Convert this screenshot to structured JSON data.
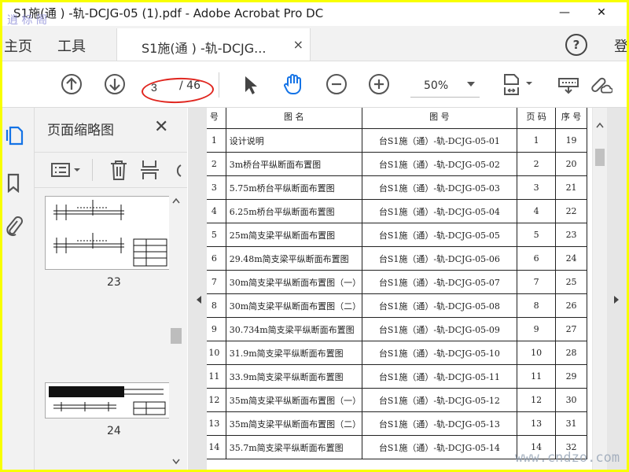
{
  "window": {
    "title": "S1施(通 ) -轨-DCJG-05 (1).pdf - Adobe Acrobat Pro DC",
    "watermark_top": "逍 标 阁",
    "minimize": "—",
    "close": "✕"
  },
  "topnav": {
    "home": "主页",
    "tools": "工具",
    "doc_tab": "S1施(通 ) -轨-DCJG...",
    "doc_tab_close": "×",
    "help": "?",
    "signin": "登"
  },
  "toolbar": {
    "page_current": "3",
    "page_total": "/ 46",
    "zoom": "50%"
  },
  "thumbnails": {
    "title": "页面缩略图",
    "pages": [
      {
        "num": "23"
      },
      {
        "num": "24"
      }
    ]
  },
  "table": {
    "headers": [
      "号",
      "图 名",
      "图 号",
      "页 码",
      "序 号"
    ],
    "rows": [
      {
        "idx": "1",
        "name": "设计说明",
        "code": "台S1施（通）-轨-DCJG-05-01",
        "page": "1",
        "seq": "19"
      },
      {
        "idx": "2",
        "name": "3m桥台平纵断面布置图",
        "code": "台S1施（通）-轨-DCJG-05-02",
        "page": "2",
        "seq": "20"
      },
      {
        "idx": "3",
        "name": "5.75m桥台平纵断面布置图",
        "code": "台S1施（通）-轨-DCJG-05-03",
        "page": "3",
        "seq": "21"
      },
      {
        "idx": "4",
        "name": "6.25m桥台平纵断面布置图",
        "code": "台S1施（通）-轨-DCJG-05-04",
        "page": "4",
        "seq": "22"
      },
      {
        "idx": "5",
        "name": "25m简支梁平纵断面布置图",
        "code": "台S1施（通）-轨-DCJG-05-05",
        "page": "5",
        "seq": "23"
      },
      {
        "idx": "6",
        "name": "29.48m简支梁平纵断面布置图",
        "code": "台S1施（通）-轨-DCJG-05-06",
        "page": "6",
        "seq": "24"
      },
      {
        "idx": "7",
        "name": "30m简支梁平纵断面布置图（一）",
        "code": "台S1施（通）-轨-DCJG-05-07",
        "page": "7",
        "seq": "25"
      },
      {
        "idx": "8",
        "name": "30m简支梁平纵断面布置图（二）",
        "code": "台S1施（通）-轨-DCJG-05-08",
        "page": "8",
        "seq": "26"
      },
      {
        "idx": "9",
        "name": "30.734m简支梁平纵断面布置图",
        "code": "台S1施（通）-轨-DCJG-05-09",
        "page": "9",
        "seq": "27"
      },
      {
        "idx": "10",
        "name": "31.9m简支梁平纵断面布置图",
        "code": "台S1施（通）-轨-DCJG-05-10",
        "page": "10",
        "seq": "28"
      },
      {
        "idx": "11",
        "name": "33.9m简支梁平纵断面布置图",
        "code": "台S1施（通）-轨-DCJG-05-11",
        "page": "11",
        "seq": "29"
      },
      {
        "idx": "12",
        "name": "35m简支梁平纵断面布置图（一）",
        "code": "台S1施（通）-轨-DCJG-05-12",
        "page": "12",
        "seq": "30"
      },
      {
        "idx": "13",
        "name": "35m简支梁平纵断面布置图（二）",
        "code": "台S1施（通）-轨-DCJG-05-13",
        "page": "13",
        "seq": "31"
      },
      {
        "idx": "14",
        "name": "35.7m简支梁平纵断面布置图",
        "code": "台S1施（通）-轨-DCJG-05-14",
        "page": "14",
        "seq": "32"
      }
    ]
  },
  "watermark_bottom": "www.cndzo.com",
  "colors": {
    "accent": "#1473e6",
    "annotation": "#e0261f",
    "frame": "#f8ff00"
  }
}
